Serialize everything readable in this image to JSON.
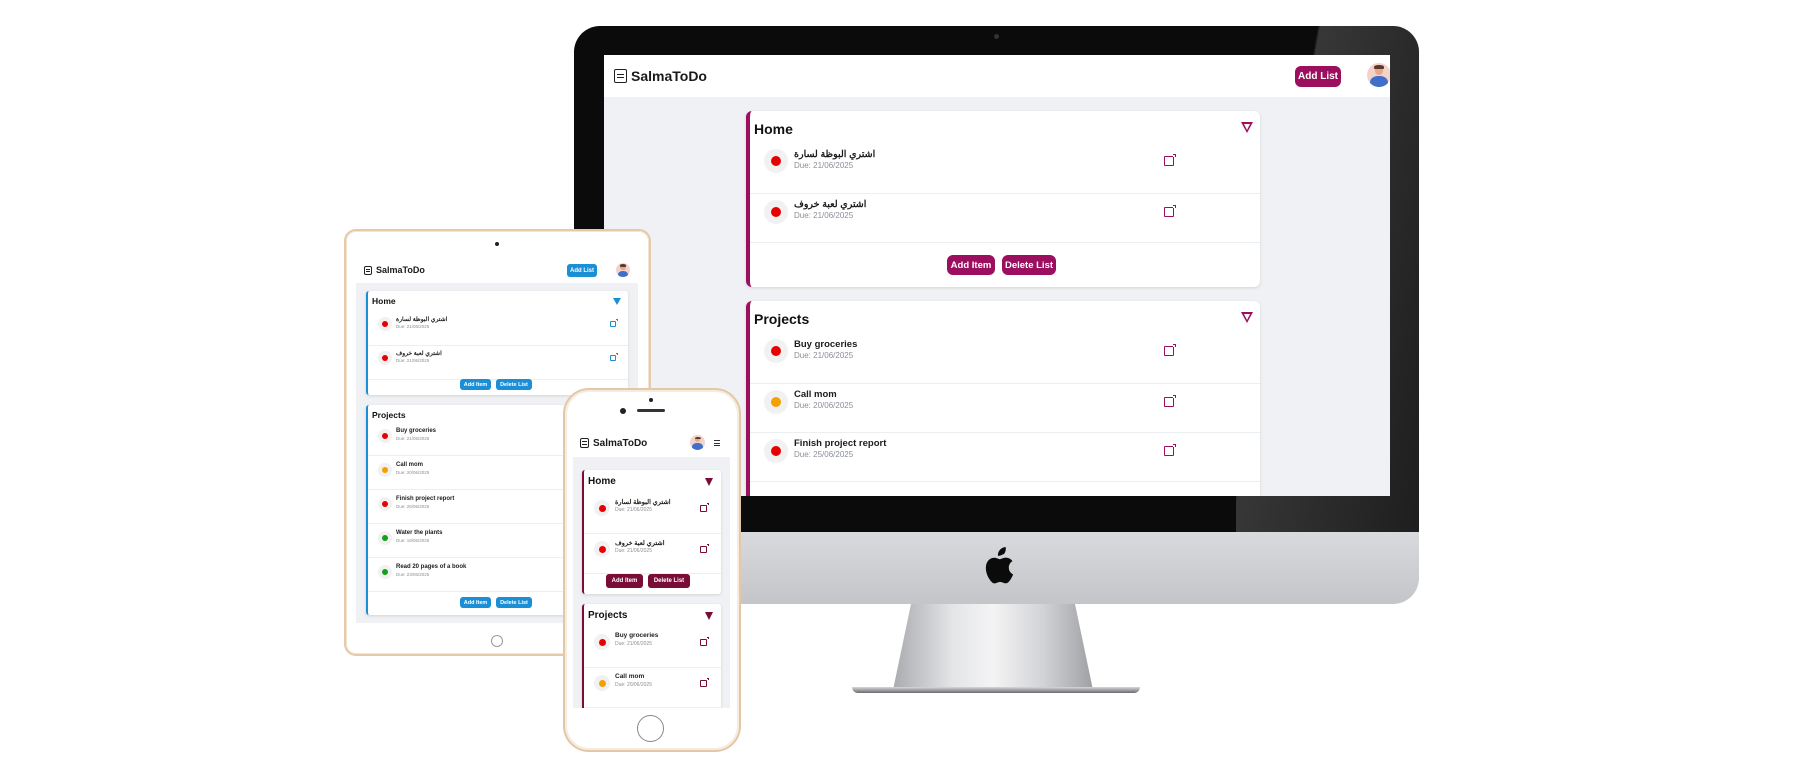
{
  "colors": {
    "accent_desktop": "#9c0f5f",
    "accent_tablet": "#1b8fd6",
    "accent_phone": "#7a0d38",
    "priority_high": "#e60000",
    "priority_medium": "#f5a000",
    "priority_low": "#15a01a"
  },
  "app": {
    "name": "SalmaToDo",
    "add_list_label": "Add List",
    "menu_icon": "hamburger-icon"
  },
  "lists": [
    {
      "title": "Home",
      "add_item_label": "Add Item",
      "delete_list_label": "Delete List",
      "tasks": [
        {
          "title": "اشتري البوظة لسارة",
          "due": "Due: 21/06/2025",
          "priority": "high"
        },
        {
          "title": "اشتري لعبة خروف",
          "due": "Due: 21/06/2025",
          "priority": "high"
        }
      ]
    },
    {
      "title": "Projects",
      "add_item_label": "Add Item",
      "delete_list_label": "Delete List",
      "tasks": [
        {
          "title": "Buy groceries",
          "due": "Due: 21/06/2025",
          "priority": "high"
        },
        {
          "title": "Call mom",
          "due": "Due: 20/06/2025",
          "priority": "medium"
        },
        {
          "title": "Finish project report",
          "due": "Due: 25/06/2025",
          "priority": "high"
        },
        {
          "title": "Water the plants",
          "due": "Due: 19/06/2025",
          "priority": "low"
        },
        {
          "title": "Read 20 pages of a book",
          "due": "Due: 23/06/2025",
          "priority": "low"
        }
      ]
    }
  ]
}
